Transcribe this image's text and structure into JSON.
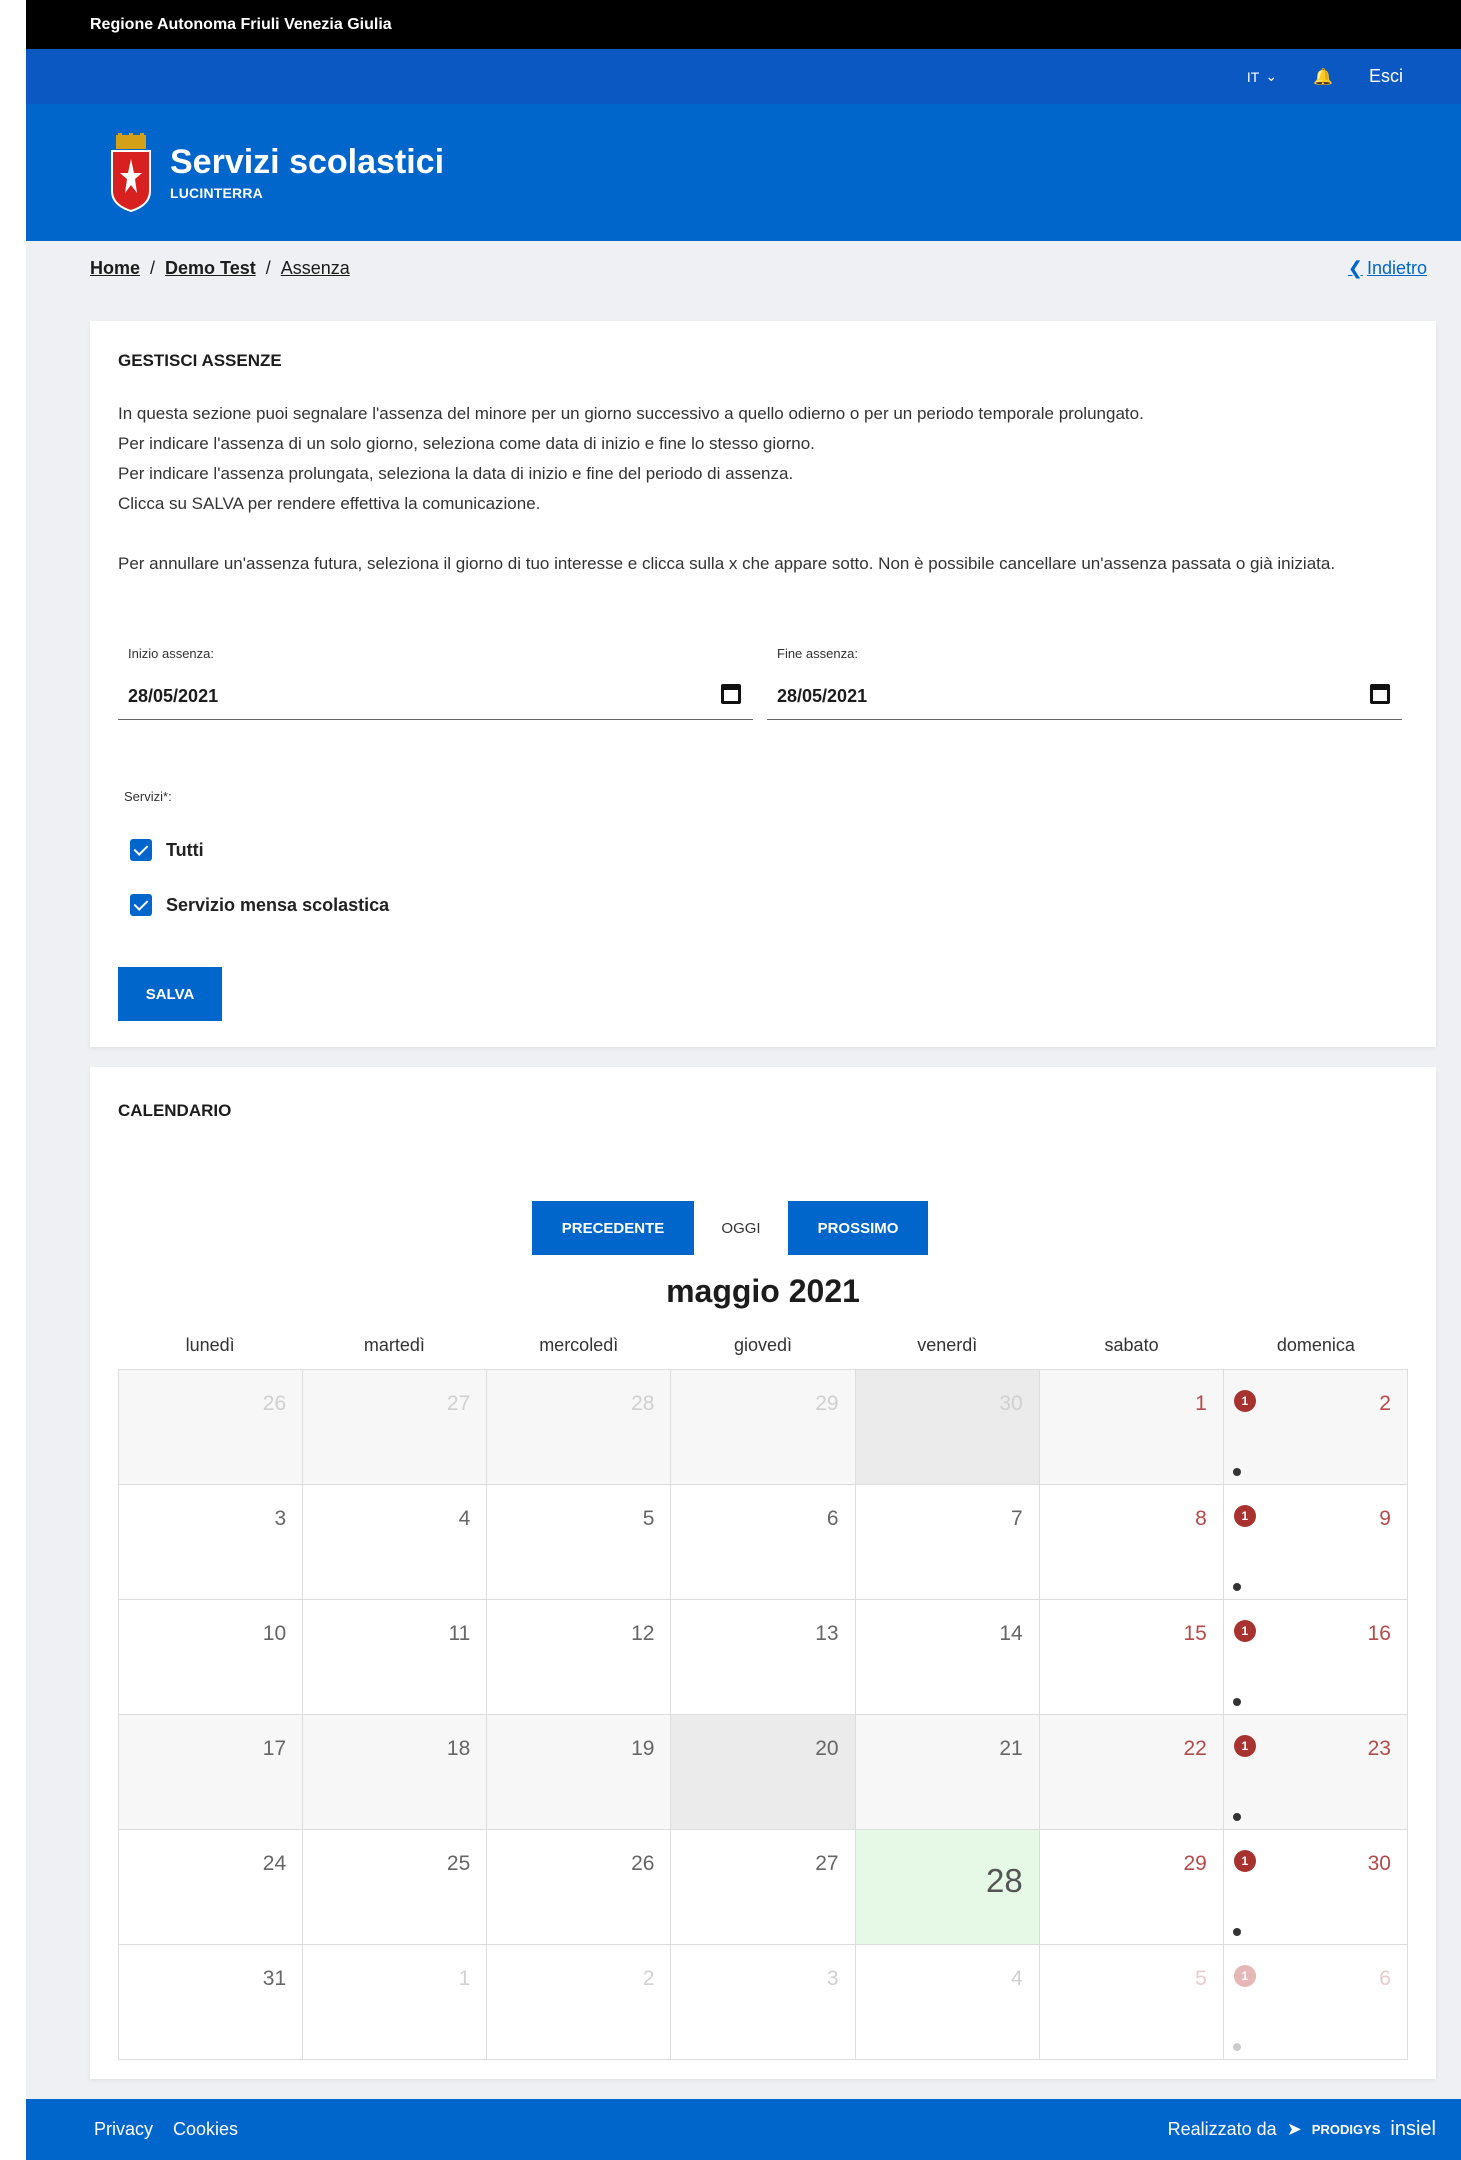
{
  "top": {
    "region": "Regione Autonoma Friuli Venezia Giulia"
  },
  "util": {
    "language": "IT",
    "logout": "Esci"
  },
  "header": {
    "title": "Servizi scolastici",
    "subtitle": "LUCINTERRA"
  },
  "breadcrumb": {
    "home": "Home",
    "demo": "Demo Test",
    "current": "Assenza",
    "back": "Indietro"
  },
  "absences": {
    "heading": "GESTISCI ASSENZE",
    "intro": [
      "In questa sezione puoi segnalare l'assenza del minore per un giorno successivo a quello odierno o per un periodo temporale prolungato.",
      "Per indicare l'assenza di un solo giorno, seleziona come data di inizio e fine lo stesso giorno.",
      "Per indicare l'assenza prolungata, seleziona la data di inizio e fine del periodo di assenza.",
      "Clicca su SALVA per rendere effettiva la comunicazione.",
      "Per annullare un'assenza futura, seleziona il giorno di tuo interesse e clicca sulla x che appare sotto. Non è possibile cancellare un'assenza passata o già iniziata."
    ],
    "start_label": "Inizio assenza:",
    "start_value": "28/05/2021",
    "end_label": "Fine assenza:",
    "end_value": "28/05/2021",
    "services_label": "Servizi*:",
    "check_all": "Tutti",
    "check_canteen": "Servizio mensa scolastica",
    "save": "SALVA"
  },
  "calendar": {
    "heading": "CALENDARIO",
    "prev": "PRECEDENTE",
    "today": "OGGI",
    "next": "PROSSIMO",
    "month": "maggio 2021",
    "weekdays": [
      "lunedì",
      "martedì",
      "mercoledì",
      "giovedì",
      "venerdì",
      "sabato",
      "domenica"
    ],
    "weeks": [
      [
        "26",
        "27",
        "28",
        "29",
        "30",
        "1",
        "2"
      ],
      [
        "3",
        "4",
        "5",
        "6",
        "7",
        "8",
        "9"
      ],
      [
        "10",
        "11",
        "12",
        "13",
        "14",
        "15",
        "16"
      ],
      [
        "17",
        "18",
        "19",
        "20",
        "21",
        "22",
        "23"
      ],
      [
        "24",
        "25",
        "26",
        "27",
        "28",
        "29",
        "30"
      ],
      [
        "31",
        "1",
        "2",
        "3",
        "4",
        "5",
        "6"
      ]
    ],
    "badge": "1"
  },
  "footer": {
    "privacy": "Privacy",
    "cookies": "Cookies",
    "made_by": "Realizzato da",
    "prodigys": "PRODIGYS",
    "insiel": "insiel"
  }
}
